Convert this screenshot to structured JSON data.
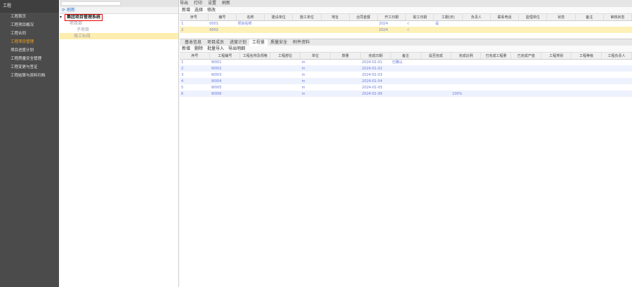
{
  "sidebar": {
    "header": "工程",
    "items": [
      {
        "label": "工程首页"
      },
      {
        "label": "工程项目概况"
      },
      {
        "label": "工程合同"
      },
      {
        "label": "工程项目管理"
      },
      {
        "label": "项目进度计划"
      },
      {
        "label": "工程质量安全管理"
      },
      {
        "label": "工程变更与签证"
      },
      {
        "label": "工程结算与资料归档"
      }
    ],
    "active_index": 3
  },
  "tree": {
    "search_placeholder": "",
    "refresh_label": "刷新",
    "root": "集团项目管理系统",
    "nodes": [
      "项目部",
      "子项目",
      "施工标段"
    ]
  },
  "toolbar": {
    "items": [
      "导出",
      "打印",
      "设置",
      "刷新"
    ]
  },
  "top_grid": {
    "toolbar": [
      "新增",
      "选择",
      "修改"
    ],
    "columns": [
      "序号",
      "编号",
      "名称",
      "建设单位",
      "施工单位",
      "地址",
      "合同金额",
      "开工日期",
      "竣工日期",
      "工期(天)",
      "负责人",
      "联系电话",
      "监理单位",
      "状态",
      "备注",
      "审核状态"
    ],
    "rows": [
      [
        "1",
        "0001",
        "项目名称",
        "",
        "",
        "",
        "",
        "2024",
        "√",
        "是",
        "",
        "",
        "",
        "",
        "",
        ""
      ],
      [
        "2",
        "0002",
        "",
        "",
        "",
        "",
        "",
        "2024",
        "√",
        "",
        "",
        "",
        "",
        "",
        "",
        ""
      ]
    ]
  },
  "tabs": [
    {
      "label": "基本信息"
    },
    {
      "label": "项目成员"
    },
    {
      "label": "进度计划"
    },
    {
      "label": "工程量"
    },
    {
      "label": "质量安全"
    },
    {
      "label": "附件资料"
    }
  ],
  "active_tab": 3,
  "bottom_grid": {
    "toolbar": [
      "新增",
      "删除",
      "批量导入",
      "导出明细"
    ],
    "columns": [
      "序号",
      "工程编号",
      "工程名称及规格",
      "工程部位",
      "单位",
      "数量",
      "完成日期",
      "备注",
      "是否完成",
      "完成比例",
      "已完成工程量",
      "已完成产值",
      "工程类别",
      "工程等级",
      "工程负责人"
    ],
    "rows": [
      [
        "1",
        "W001",
        "",
        "",
        "m",
        "",
        "2024-01-01",
        "已确认",
        "",
        "",
        "",
        "",
        "",
        "",
        ""
      ],
      [
        "2",
        "W002",
        "",
        "",
        "m",
        "",
        "2024-01-02",
        "",
        "",
        "",
        "",
        "",
        "",
        "",
        ""
      ],
      [
        "3",
        "W003",
        "",
        "",
        "m",
        "",
        "2024-01-03",
        "",
        "",
        "",
        "",
        "",
        "",
        "",
        ""
      ],
      [
        "4",
        "W004",
        "",
        "",
        "m",
        "",
        "2024-01-04",
        "",
        "",
        "",
        "",
        "",
        "",
        "",
        ""
      ],
      [
        "5",
        "W005",
        "",
        "",
        "m",
        "",
        "2024-01-05",
        "",
        "",
        "",
        "",
        "",
        "",
        "",
        ""
      ],
      [
        "6",
        "W006",
        "",
        "",
        "m",
        "",
        "2024-01-06",
        "",
        "",
        "100%",
        "",
        "",
        "",
        "",
        ""
      ]
    ]
  }
}
